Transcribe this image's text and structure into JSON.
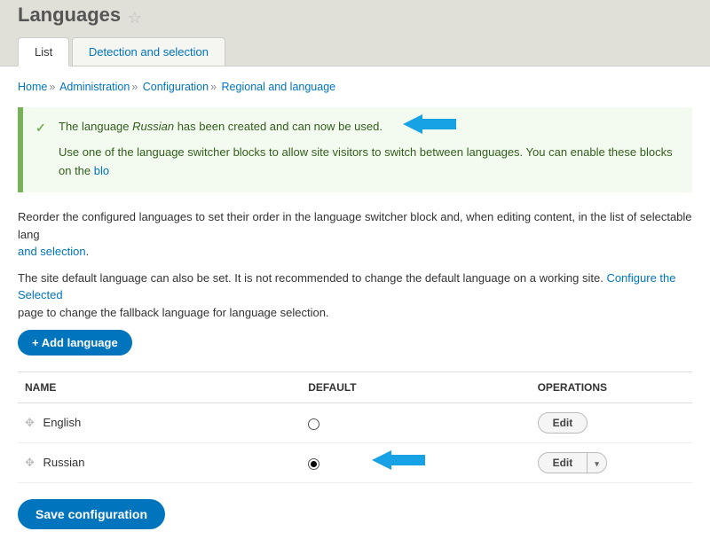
{
  "page": {
    "title": "Languages"
  },
  "tabs": {
    "list": "List",
    "detection": "Detection and selection"
  },
  "breadcrumb": {
    "home": "Home",
    "admin": "Administration",
    "config": "Configuration",
    "regional": "Regional and language"
  },
  "message": {
    "pre": "The language ",
    "lang": "Russian",
    "post": " has been created and can now be used.",
    "hint_pre": "Use one of the language switcher blocks to allow site visitors to switch between languages. You can enable these blocks on the ",
    "hint_link": "blo"
  },
  "intro": {
    "p1_pre": "Reorder the configured languages to set their order in the language switcher block and, when editing content, in the list of selectable lang",
    "p1_link": "and selection",
    "p1_dot": ".",
    "p2_pre": "The site default language can also be set. It is not recommended to change the default language on a working site. ",
    "p2_link": "Configure the Selected",
    "p2_post": " page to change the fallback language for language selection."
  },
  "buttons": {
    "add": "+ Add language",
    "save": "Save configuration",
    "edit": "Edit"
  },
  "table": {
    "headers": {
      "name": "NAME",
      "default": "DEFAULT",
      "ops": "OPERATIONS"
    },
    "rows": [
      {
        "name": "English",
        "default": false,
        "split": false
      },
      {
        "name": "Russian",
        "default": true,
        "split": true
      }
    ]
  }
}
